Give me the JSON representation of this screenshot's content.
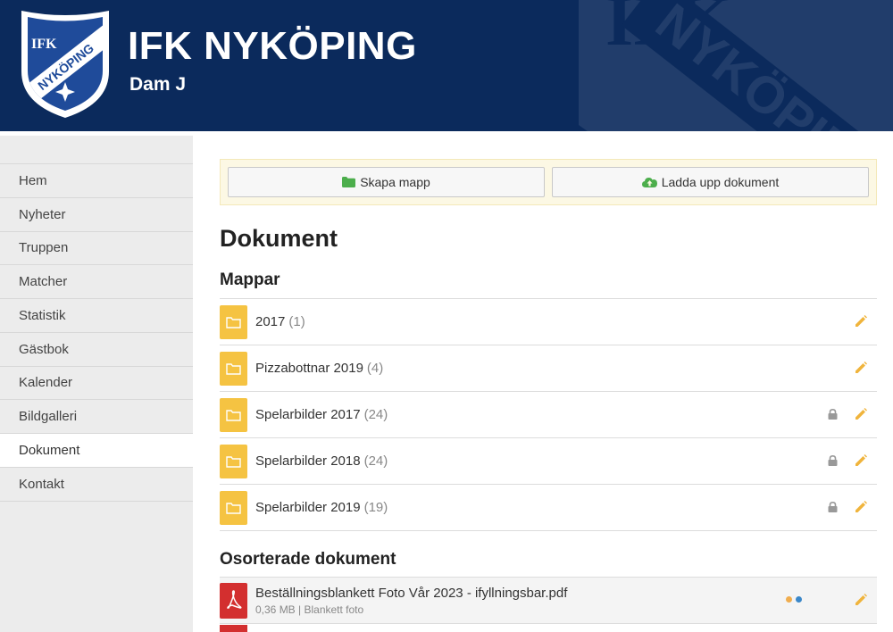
{
  "header": {
    "club_name": "IFK NYKÖPING",
    "team_name": "Dam J",
    "crest_text_top": "IFK",
    "crest_text_band": "NYKÖPING",
    "watermark_text_top": "IFK",
    "watermark_text_band": "NYKÖPING"
  },
  "sidebar": {
    "items": [
      {
        "label": "Hem"
      },
      {
        "label": "Nyheter"
      },
      {
        "label": "Truppen"
      },
      {
        "label": "Matcher"
      },
      {
        "label": "Statistik"
      },
      {
        "label": "Gästbok"
      },
      {
        "label": "Kalender"
      },
      {
        "label": "Bildgalleri"
      },
      {
        "label": "Dokument",
        "active": true
      },
      {
        "label": "Kontakt"
      }
    ]
  },
  "toolbar": {
    "create_folder_label": "Skapa mapp",
    "upload_label": "Ladda upp dokument"
  },
  "main": {
    "title": "Dokument",
    "folders_heading": "Mappar",
    "folders": [
      {
        "name": "2017",
        "count": "(1)",
        "locked": false
      },
      {
        "name": "Pizzabottnar 2019",
        "count": "(4)",
        "locked": false
      },
      {
        "name": "Spelarbilder 2017",
        "count": "(24)",
        "locked": true
      },
      {
        "name": "Spelarbilder 2018",
        "count": "(24)",
        "locked": true
      },
      {
        "name": "Spelarbilder 2019",
        "count": "(19)",
        "locked": true
      }
    ],
    "unsorted_heading": "Osorterade dokument",
    "documents": [
      {
        "name": "Beställningsblankett Foto Vår 2023 - ifyllningsbar.pdf",
        "meta": "0,36 MB | Blankett foto"
      }
    ]
  },
  "colors": {
    "header_bg": "#0b2a5c",
    "folder": "#f5c342",
    "pencil": "#f0b43c",
    "create_icon": "#4cae4c",
    "upload_icon": "#4cae4c",
    "pdf": "#d32f2f",
    "dot_orange": "#f0ad4e",
    "dot_blue": "#3a87c9",
    "lock": "#999999"
  }
}
